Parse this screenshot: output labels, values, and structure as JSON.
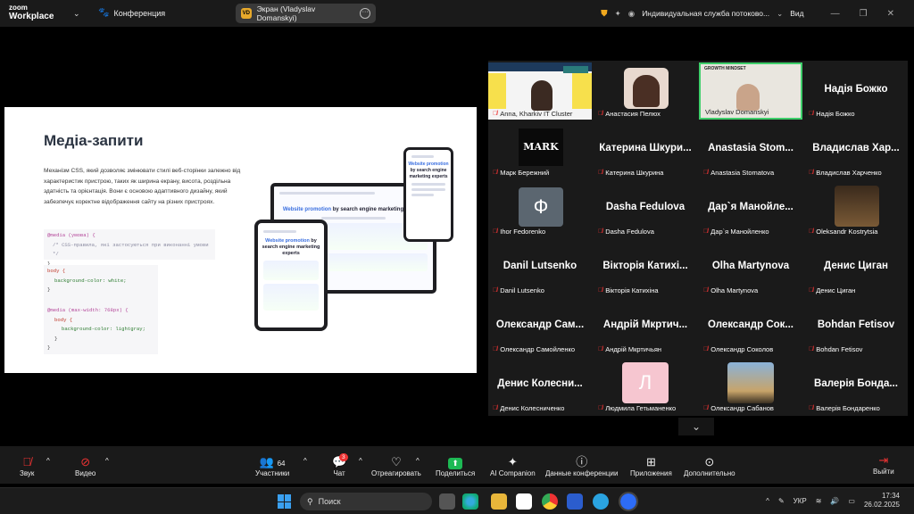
{
  "app": {
    "logo_line1": "zoom",
    "logo_line2": "Workplace",
    "meeting_label": "Конференция",
    "share_label": "Экран (Vladyslav Domanskyi)",
    "share_initials": "VD",
    "service_label": "Индивидуальная служба потоково...",
    "view_label": "Вид"
  },
  "slide": {
    "title": "Медіа-запити",
    "description": "Механізм CSS, який дозволяє змінювати стилі веб-сторінки залежно від характеристик пристрою, таких як ширина екрану, висота, роздільна здатність та орієнтація. Вони є основою адаптивного дизайну, який забезпечує коректне відображення сайту на різних пристроях.",
    "code1_l1": "@media (умова) {",
    "code1_l2": "/* CSS-правила, які застосуються при виконанні умови */",
    "code1_l3": "}",
    "code2_l1": "body {",
    "code2_l2": "background-color: white;",
    "code2_l3": "}",
    "code3_l1": "@media (max-width: 768px) {",
    "code3_l2": "body {",
    "code3_l3": "background-color: lightgray;",
    "code3_l4": "}",
    "code3_l5": "}",
    "mock_heading_blue": "Website promotion",
    "mock_heading_rest": "by search engine marketing experts"
  },
  "participants": [
    {
      "caption": "Anna, Kharkiv IT Cluster",
      "big": ""
    },
    {
      "caption": "Анастасия Пелюх",
      "big": ""
    },
    {
      "caption": "Vladyslav Domanskyi",
      "big": ""
    },
    {
      "caption": "Надія Божко",
      "big": "Надія Божко"
    },
    {
      "caption": "Марк Бережний",
      "big": ""
    },
    {
      "caption": "Катерина Шкурина",
      "big": "Катерина Шкури..."
    },
    {
      "caption": "Anastasia Stomatova",
      "big": "Anastasia Stom..."
    },
    {
      "caption": "Владислав Харченко",
      "big": "Владислав Хар..."
    },
    {
      "caption": "Ihor Fedorenko",
      "big": ""
    },
    {
      "caption": "Dasha Fedulova",
      "big": "Dasha Fedulova"
    },
    {
      "caption": "Дар`я Манойленко",
      "big": "Дар`я Манойле..."
    },
    {
      "caption": "Oleksandr Kostrytsia",
      "big": ""
    },
    {
      "caption": "Danil Lutsenko",
      "big": "Danil Lutsenko"
    },
    {
      "caption": "Вікторія Катихіна",
      "big": "Вікторія Катихі..."
    },
    {
      "caption": "Olha Martynova",
      "big": "Olha Martynova"
    },
    {
      "caption": "Денис Циган",
      "big": "Денис Циган"
    },
    {
      "caption": "Олександр Самойленко",
      "big": "Олександр Сам..."
    },
    {
      "caption": "Андрій Мкртичьян",
      "big": "Андрій Мкртич..."
    },
    {
      "caption": "Олександр Соколов",
      "big": "Олександр Сок..."
    },
    {
      "caption": "Bohdan Fetisov",
      "big": "Bohdan Fetisov"
    },
    {
      "caption": "Денис Колесниченко",
      "big": "Денис Колесни..."
    },
    {
      "caption": "Людмила Гетьманенко",
      "big": ""
    },
    {
      "caption": "Олександр Сабанов",
      "big": ""
    },
    {
      "caption": "Валерія Бондаренко",
      "big": "Валерія Бонда..."
    }
  ],
  "avatars": {
    "mark_text": "MARK",
    "ihor_letter": "Ф",
    "ludmila_letter": "Л"
  },
  "toolbar": {
    "mute": "Звук",
    "video": "Видео",
    "participants": "Участники",
    "participants_count": "64",
    "chat": "Чат",
    "chat_badge": "3",
    "react": "Отреагировать",
    "share": "Поделиться",
    "ai": "AI Companion",
    "info": "Данные конференции",
    "apps": "Приложения",
    "more": "Дополнительно",
    "leave": "Выйти"
  },
  "taskbar": {
    "search_placeholder": "Поиск",
    "lang": "УКР",
    "time": "17:34",
    "date": "26.02.2025"
  },
  "colors": {
    "accent_green": "#3fcf6b",
    "mic_off_red": "#e33333",
    "share_green": "#1db954"
  }
}
